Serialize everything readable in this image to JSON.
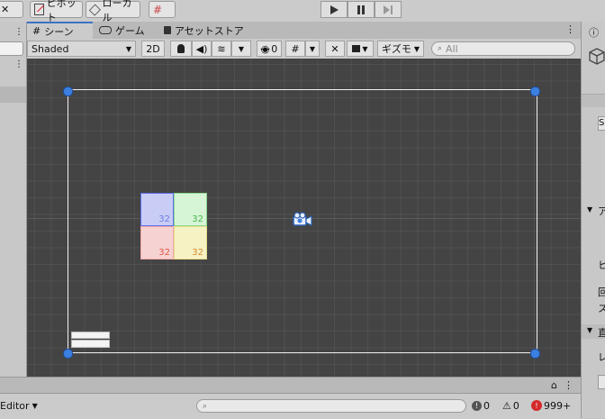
{
  "toolbar": {
    "pivot_label": "ピボット",
    "local_label": "ローカル"
  },
  "tabs": [
    {
      "label": "シーン",
      "icon": "grid-icon"
    },
    {
      "label": "ゲーム",
      "icon": "gamepad-icon"
    },
    {
      "label": "アセットストア",
      "icon": "bag-icon"
    }
  ],
  "scene_toolbar": {
    "shading_mode": "Shaded",
    "mode_2d": "2D",
    "hidden_count": "0",
    "gizmos_label": "ギズモ",
    "search_placeholder": "All"
  },
  "sprite_tiles": [
    {
      "label": "32",
      "fill": "#c9cdf6",
      "border": "#5b6de6",
      "text": "#6c7fe0"
    },
    {
      "label": "32",
      "fill": "#d6f5d6",
      "border": "#8fd98f",
      "text": "#49b94c"
    },
    {
      "label": "32",
      "fill": "#f6d2d2",
      "border": "#f0a9a9",
      "text": "#e05a4a"
    },
    {
      "label": "32",
      "fill": "#f6f2c4",
      "border": "#e6dc8a",
      "text": "#d88a2e"
    }
  ],
  "console": {
    "filter_label": "Editor",
    "info_count": "0",
    "warning_count": "0",
    "error_count": "999+"
  },
  "inspector": {
    "labels": [
      "S",
      "ア",
      "ヒ",
      "回",
      "ス",
      "直",
      "レ"
    ]
  },
  "colors": {
    "scene_bg": "#444444",
    "accent": "#3a72c6",
    "error": "#d42a2a"
  }
}
